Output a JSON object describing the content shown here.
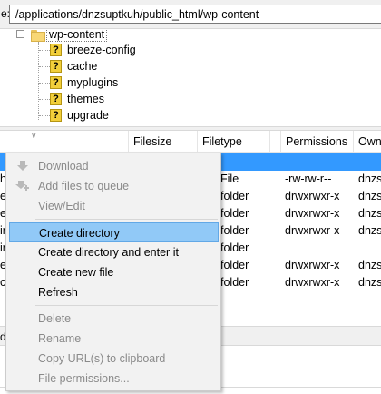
{
  "path_bar": {
    "label": "e:",
    "value": "/applications/dnzsuptkuh/public_html/wp-content"
  },
  "tree": {
    "root": "wp-content",
    "children": [
      "breeze-config",
      "cache",
      "myplugins",
      "themes",
      "upgrade"
    ],
    "unknown_icon_glyph": "?"
  },
  "header": {
    "filesize": "Filesize",
    "filetype": "Filetype",
    "permissions": "Permissions",
    "owner": "Own"
  },
  "rows": [
    {
      "name": "",
      "type": "",
      "perm": "",
      "owner": ""
    },
    {
      "name": "",
      "type": "File",
      "perm": "-rw-rw-r--",
      "owner": "dnzs"
    },
    {
      "name": "",
      "type": "folder",
      "perm": "drwxrwxr-x",
      "owner": "dnzs"
    },
    {
      "name": "",
      "type": "folder",
      "perm": "drwxrwxr-x",
      "owner": "dnzs"
    },
    {
      "name": "",
      "type": "folder",
      "perm": "drwxrwxr-x",
      "owner": "dnzs"
    },
    {
      "name": "",
      "type": "folder",
      "perm": "",
      "owner": ""
    },
    {
      "name": "",
      "type": "folder",
      "perm": "drwxrwxr-x",
      "owner": "dnzs"
    },
    {
      "name": "",
      "type": "folder",
      "perm": "drwxrwxr-x",
      "owner": "dnzs"
    }
  ],
  "row_name_glyphs": [
    "",
    "h",
    "e",
    "e",
    "ir",
    "ir",
    "e",
    "c"
  ],
  "status": {
    "text": "d"
  },
  "context_menu": {
    "download": "Download",
    "add_to_queue": "Add files to queue",
    "view_edit": "View/Edit",
    "create_directory": "Create directory",
    "create_directory_enter": "Create directory and enter it",
    "create_new_file": "Create new file",
    "refresh": "Refresh",
    "delete": "Delete",
    "rename": "Rename",
    "copy_urls": "Copy URL(s) to clipboard",
    "file_permissions": "File permissions..."
  },
  "colors": {
    "selection": "#3399ff",
    "menu_highlight": "#91c9f7",
    "folder": "#f8d775",
    "unknown_icon": "#f2cf3b"
  }
}
